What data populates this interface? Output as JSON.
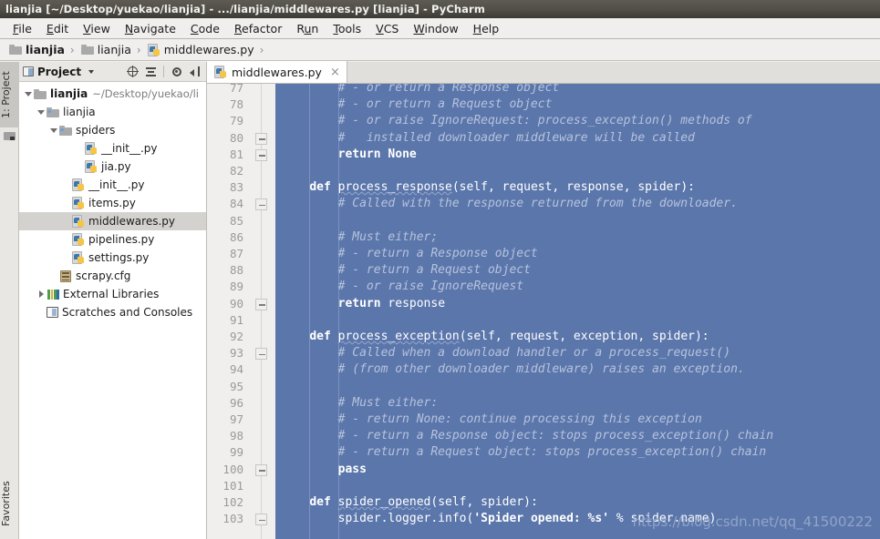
{
  "window": {
    "title": "lianjia [~/Desktop/yuekao/lianjia] - .../lianjia/middlewares.py [lianjia] - PyCharm"
  },
  "menu": [
    {
      "label": "File",
      "mnemonic": "F"
    },
    {
      "label": "Edit",
      "mnemonic": "E"
    },
    {
      "label": "View",
      "mnemonic": "V"
    },
    {
      "label": "Navigate",
      "mnemonic": "N"
    },
    {
      "label": "Code",
      "mnemonic": "C"
    },
    {
      "label": "Refactor",
      "mnemonic": "R"
    },
    {
      "label": "Run",
      "mnemonic": "u"
    },
    {
      "label": "Tools",
      "mnemonic": "T"
    },
    {
      "label": "VCS",
      "mnemonic": "V"
    },
    {
      "label": "Window",
      "mnemonic": "W"
    },
    {
      "label": "Help",
      "mnemonic": "H"
    }
  ],
  "breadcrumb": [
    {
      "label": "lianjia",
      "icon": "folder-icon",
      "bold": true
    },
    {
      "label": "lianjia",
      "icon": "folder-icon",
      "bold": false
    },
    {
      "label": "middlewares.py",
      "icon": "python-file-icon",
      "bold": false
    }
  ],
  "left_strip": {
    "project_tab": "1: Project",
    "favorites_tab": "Favorites"
  },
  "project_panel": {
    "title": "Project",
    "tools": [
      "locate-icon",
      "collapse-all-icon",
      "settings-gear-icon",
      "hide-panel-icon"
    ],
    "tree": [
      {
        "label": "lianjia",
        "path": "~/Desktop/yuekao/li",
        "icon": "folder-icon",
        "indent": 0,
        "twisty": "down",
        "bold": true,
        "selected": false
      },
      {
        "label": "lianjia",
        "path": "",
        "icon": "folder-blue-icon",
        "indent": 1,
        "twisty": "down",
        "bold": false,
        "selected": false
      },
      {
        "label": "spiders",
        "path": "",
        "icon": "folder-blue-icon",
        "indent": 2,
        "twisty": "down",
        "bold": false,
        "selected": false
      },
      {
        "label": "__init__.py",
        "path": "",
        "icon": "python-file-icon",
        "indent": 4,
        "twisty": "none",
        "bold": false,
        "selected": false
      },
      {
        "label": "jia.py",
        "path": "",
        "icon": "python-file-icon",
        "indent": 4,
        "twisty": "none",
        "bold": false,
        "selected": false
      },
      {
        "label": "__init__.py",
        "path": "",
        "icon": "python-file-icon",
        "indent": 3,
        "twisty": "none",
        "bold": false,
        "selected": false
      },
      {
        "label": "items.py",
        "path": "",
        "icon": "python-file-icon",
        "indent": 3,
        "twisty": "none",
        "bold": false,
        "selected": false
      },
      {
        "label": "middlewares.py",
        "path": "",
        "icon": "python-file-icon",
        "indent": 3,
        "twisty": "none",
        "bold": false,
        "selected": true
      },
      {
        "label": "pipelines.py",
        "path": "",
        "icon": "python-file-icon",
        "indent": 3,
        "twisty": "none",
        "bold": false,
        "selected": false
      },
      {
        "label": "settings.py",
        "path": "",
        "icon": "python-file-icon",
        "indent": 3,
        "twisty": "none",
        "bold": false,
        "selected": false
      },
      {
        "label": "scrapy.cfg",
        "path": "",
        "icon": "config-file-icon",
        "indent": 2,
        "twisty": "none",
        "bold": false,
        "selected": false
      },
      {
        "label": "External Libraries",
        "path": "",
        "icon": "libraries-icon",
        "indent": 1,
        "twisty": "right",
        "bold": false,
        "selected": false
      },
      {
        "label": "Scratches and Consoles",
        "path": "",
        "icon": "scratches-icon",
        "indent": 1,
        "twisty": "none",
        "bold": false,
        "selected": false
      }
    ]
  },
  "editor": {
    "tab": {
      "label": "middlewares.py",
      "icon": "python-file-icon",
      "close": "×"
    },
    "first_line_number": 77,
    "lines": [
      {
        "n": 77,
        "fold": "none",
        "segments": [
          {
            "t": "        # - or return a Response object",
            "c": "cm"
          }
        ]
      },
      {
        "n": 78,
        "fold": "none",
        "segments": [
          {
            "t": "        # - or return a Request object",
            "c": "cm"
          }
        ]
      },
      {
        "n": 79,
        "fold": "none",
        "segments": [
          {
            "t": "        # - or raise IgnoreRequest: process_exception() methods of",
            "c": "cm"
          }
        ]
      },
      {
        "n": 80,
        "fold": "box",
        "segments": [
          {
            "t": "        #   installed downloader middleware will be called",
            "c": "cm"
          }
        ]
      },
      {
        "n": 81,
        "fold": "box",
        "segments": [
          {
            "t": "        ",
            "c": "pl"
          },
          {
            "t": "return None",
            "c": "kw"
          }
        ]
      },
      {
        "n": 82,
        "fold": "none",
        "segments": [
          {
            "t": "",
            "c": "pl"
          }
        ]
      },
      {
        "n": 83,
        "fold": "none",
        "segments": [
          {
            "t": "    ",
            "c": "pl"
          },
          {
            "t": "def ",
            "c": "kw"
          },
          {
            "t": "process_response",
            "c": "fn squig"
          },
          {
            "t": "(self, request, response, spider):",
            "c": "pl"
          }
        ]
      },
      {
        "n": 84,
        "fold": "boxtip",
        "segments": [
          {
            "t": "        # Called with the response returned from the downloader.",
            "c": "cm"
          }
        ]
      },
      {
        "n": 85,
        "fold": "none",
        "segments": [
          {
            "t": "",
            "c": "pl"
          }
        ]
      },
      {
        "n": 86,
        "fold": "none",
        "segments": [
          {
            "t": "        # Must either;",
            "c": "cm"
          }
        ]
      },
      {
        "n": 87,
        "fold": "none",
        "segments": [
          {
            "t": "        # - return a Response object",
            "c": "cm"
          }
        ]
      },
      {
        "n": 88,
        "fold": "none",
        "segments": [
          {
            "t": "        # - return a Request object",
            "c": "cm"
          }
        ]
      },
      {
        "n": 89,
        "fold": "none",
        "segments": [
          {
            "t": "        # - or raise IgnoreRequest",
            "c": "cm"
          }
        ]
      },
      {
        "n": 90,
        "fold": "box",
        "segments": [
          {
            "t": "        ",
            "c": "pl"
          },
          {
            "t": "return ",
            "c": "kw"
          },
          {
            "t": "response",
            "c": "pl"
          }
        ]
      },
      {
        "n": 91,
        "fold": "none",
        "segments": [
          {
            "t": "",
            "c": "pl"
          }
        ]
      },
      {
        "n": 92,
        "fold": "none",
        "segments": [
          {
            "t": "    ",
            "c": "pl"
          },
          {
            "t": "def ",
            "c": "kw"
          },
          {
            "t": "process_exception",
            "c": "fn squig"
          },
          {
            "t": "(self, request, exception, spider):",
            "c": "pl"
          }
        ]
      },
      {
        "n": 93,
        "fold": "boxtip",
        "segments": [
          {
            "t": "        # Called when a download handler or a process_request()",
            "c": "cm"
          }
        ]
      },
      {
        "n": 94,
        "fold": "none",
        "segments": [
          {
            "t": "        # (from other downloader middleware) raises an exception.",
            "c": "cm"
          }
        ]
      },
      {
        "n": 95,
        "fold": "none",
        "segments": [
          {
            "t": "",
            "c": "pl"
          }
        ]
      },
      {
        "n": 96,
        "fold": "none",
        "segments": [
          {
            "t": "        # Must either:",
            "c": "cm"
          }
        ]
      },
      {
        "n": 97,
        "fold": "none",
        "segments": [
          {
            "t": "        # - return None: continue processing this exception",
            "c": "cm"
          }
        ]
      },
      {
        "n": 98,
        "fold": "none",
        "segments": [
          {
            "t": "        # - return a Response object: stops process_exception() chain",
            "c": "cm"
          }
        ]
      },
      {
        "n": 99,
        "fold": "none",
        "segments": [
          {
            "t": "        # - return a Request object: stops process_exception() chain",
            "c": "cm"
          }
        ]
      },
      {
        "n": 100,
        "fold": "box",
        "segments": [
          {
            "t": "        ",
            "c": "pl"
          },
          {
            "t": "pass",
            "c": "kw"
          }
        ]
      },
      {
        "n": 101,
        "fold": "none",
        "segments": [
          {
            "t": "",
            "c": "pl"
          }
        ]
      },
      {
        "n": 102,
        "fold": "bulb",
        "segments": [
          {
            "t": "    ",
            "c": "pl"
          },
          {
            "t": "def ",
            "c": "kw"
          },
          {
            "t": "spider_opened",
            "c": "fn squig"
          },
          {
            "t": "(self, spider):",
            "c": "pl"
          }
        ]
      },
      {
        "n": 103,
        "fold": "box",
        "segments": [
          {
            "t": "        spider.logger.info(",
            "c": "pl"
          },
          {
            "t": "'Spider opened: %s'",
            "c": "str"
          },
          {
            "t": " % spider.name)",
            "c": "pl"
          }
        ]
      }
    ]
  },
  "watermark": "https://blog.csdn.net/qq_41500222",
  "colors": {
    "editor_background": "#5b76ab",
    "comment": "#b6c3dd",
    "keyword": "#ffffff",
    "gutter_background": "#f0efed",
    "line_number": "#9a9a9a",
    "titlebar": "#514e47",
    "selection_row": "#d4d2ce"
  }
}
